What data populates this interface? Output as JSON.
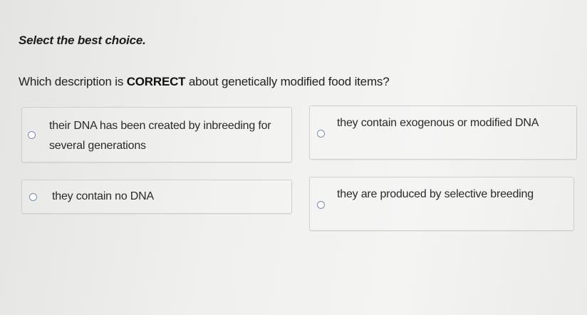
{
  "instruction": "Select the best choice.",
  "question": {
    "prefix": "Which description is ",
    "emphasis": "CORRECT",
    "suffix": " about genetically modified food items?"
  },
  "options": [
    {
      "label": "their DNA has been created by inbreeding for several generations",
      "selected": false
    },
    {
      "label": "they contain exogenous or modified DNA",
      "selected": false
    },
    {
      "label": "they contain no DNA",
      "selected": false
    },
    {
      "label": "they are produced by selective breeding",
      "selected": false
    }
  ]
}
